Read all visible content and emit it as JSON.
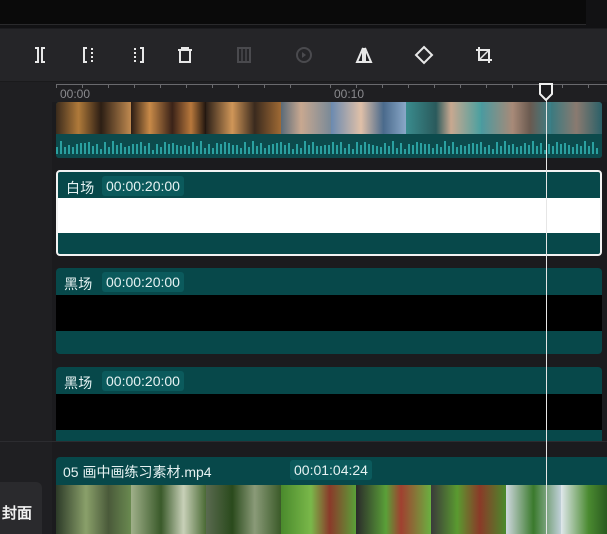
{
  "toolbar": {
    "tools": [
      {
        "name": "split-icon",
        "enabled": true
      },
      {
        "name": "delete-left-icon",
        "enabled": true
      },
      {
        "name": "delete-right-icon",
        "enabled": true
      },
      {
        "name": "delete-icon",
        "enabled": true
      },
      {
        "name": "freeze-frame-icon",
        "enabled": false
      },
      {
        "name": "reverse-icon",
        "enabled": false
      },
      {
        "name": "mirror-icon",
        "enabled": true
      },
      {
        "name": "rotate-icon",
        "enabled": true
      },
      {
        "name": "crop-icon",
        "enabled": true
      }
    ]
  },
  "ruler": {
    "labels": [
      "00:00",
      "00:10"
    ]
  },
  "tracks": {
    "white_clip": {
      "label": "白场",
      "duration": "00:00:20:00"
    },
    "black_clip_1": {
      "label": "黑场",
      "duration": "00:00:20:00"
    },
    "black_clip_2": {
      "label": "黑场",
      "duration": "00:00:20:00"
    },
    "video_clip": {
      "label": "05 画中画练习素材.mp4",
      "duration": "00:01:04:24"
    }
  },
  "cover_button": {
    "label": "封面"
  },
  "colors": {
    "clip_teal": "#07484a",
    "clip_header": "#0b5a5c",
    "white_body": "#ffffff",
    "black_body": "#000000",
    "playhead": "#e6e6e6"
  }
}
